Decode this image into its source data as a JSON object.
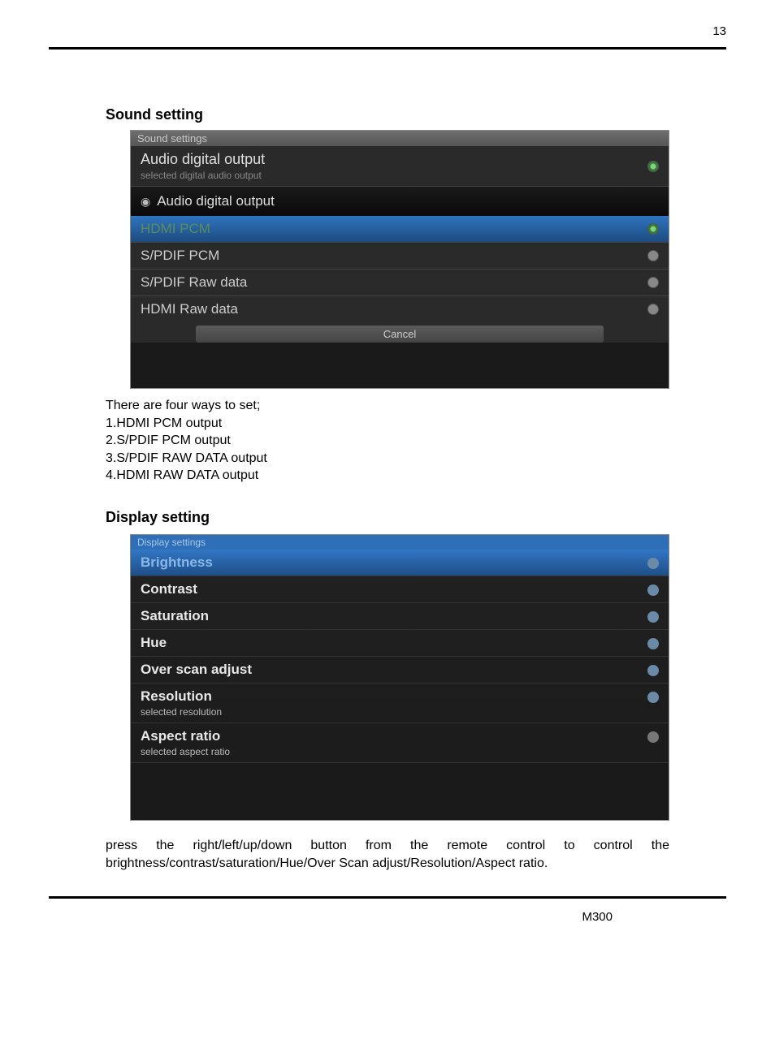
{
  "page": {
    "number": "13",
    "model": "M300"
  },
  "sound": {
    "heading": "Sound setting",
    "panelTitle": "Sound settings",
    "mainItem": {
      "label": "Audio digital output",
      "sublabel": "selected digital audio output"
    },
    "dialogTitle": "Audio digital output",
    "options": [
      {
        "label": "HDMI PCM",
        "selected": true
      },
      {
        "label": "S/PDIF PCM",
        "selected": false
      },
      {
        "label": "S/PDIF Raw data",
        "selected": false
      },
      {
        "label": "HDMI Raw data",
        "selected": false
      }
    ],
    "cancel": "Cancel",
    "explain": [
      "There are four ways to set;",
      "1.HDMI PCM output",
      "2.S/PDIF PCM output",
      "3.S/PDIF RAW DATA output",
      "4.HDMI RAW DATA output"
    ]
  },
  "display": {
    "heading": "Display setting",
    "panelTitle": "Display settings",
    "items": [
      {
        "label": "Brightness",
        "sub": "",
        "selected": true
      },
      {
        "label": "Contrast",
        "sub": "",
        "selected": false
      },
      {
        "label": "Saturation",
        "sub": "",
        "selected": false
      },
      {
        "label": "Hue",
        "sub": "",
        "selected": false
      },
      {
        "label": "Over scan adjust",
        "sub": "",
        "selected": false
      },
      {
        "label": "Resolution",
        "sub": "selected resolution",
        "selected": false
      },
      {
        "label": "Aspect ratio",
        "sub": "selected aspect ratio",
        "selected": false
      }
    ],
    "explain": "press the right/left/up/down button from the remote control to control the brightness/contrast/saturation/Hue/Over Scan adjust/Resolution/Aspect ratio."
  }
}
